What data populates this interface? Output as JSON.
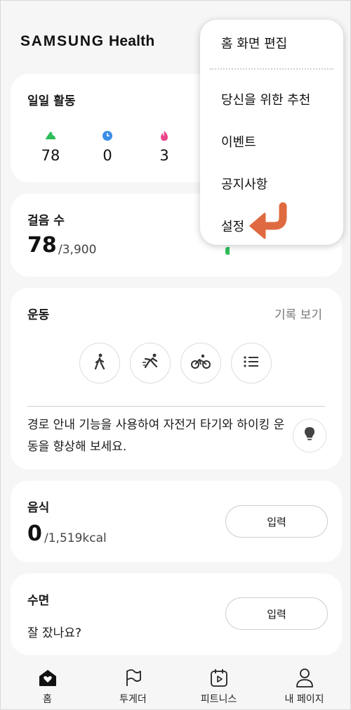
{
  "app": {
    "brand": "SAMSUNG",
    "name": "Health"
  },
  "daily_activity": {
    "title": "일일 활동",
    "items": [
      {
        "icon": "shoe-icon",
        "value": "78",
        "color": "#2ebd59"
      },
      {
        "icon": "clock-icon",
        "value": "0",
        "color": "#3a8ee6"
      },
      {
        "icon": "flame-icon",
        "value": "3",
        "color": "#e8458b"
      }
    ]
  },
  "steps": {
    "title": "걸음 수",
    "value": "78",
    "goal": "/3,900",
    "indicator_color": "#2ebd59"
  },
  "exercise": {
    "title": "운동",
    "history_link": "기록 보기",
    "buttons": [
      "walking-icon",
      "running-icon",
      "cycling-icon",
      "list-icon"
    ],
    "tip": "경로 안내 기능을 사용하여 자전거 타기와 하이킹 운동을 향상해 보세요."
  },
  "food": {
    "title": "음식",
    "value": "0",
    "goal": "/1,519kcal",
    "button": "입력"
  },
  "sleep": {
    "title": "수면",
    "question": "잘 잤나요?",
    "button": "입력"
  },
  "menu": {
    "items": [
      "홈 화면 편집",
      "당신을 위한 추천",
      "이벤트",
      "공지사항",
      "설정"
    ],
    "arrow_color": "#e06a3f"
  },
  "bottom_nav": [
    {
      "label": "홈",
      "icon": "home-heart-icon"
    },
    {
      "label": "투게더",
      "icon": "flag-icon"
    },
    {
      "label": "피트니스",
      "icon": "fitness-calendar-icon"
    },
    {
      "label": "내 페이지",
      "icon": "person-icon"
    }
  ]
}
